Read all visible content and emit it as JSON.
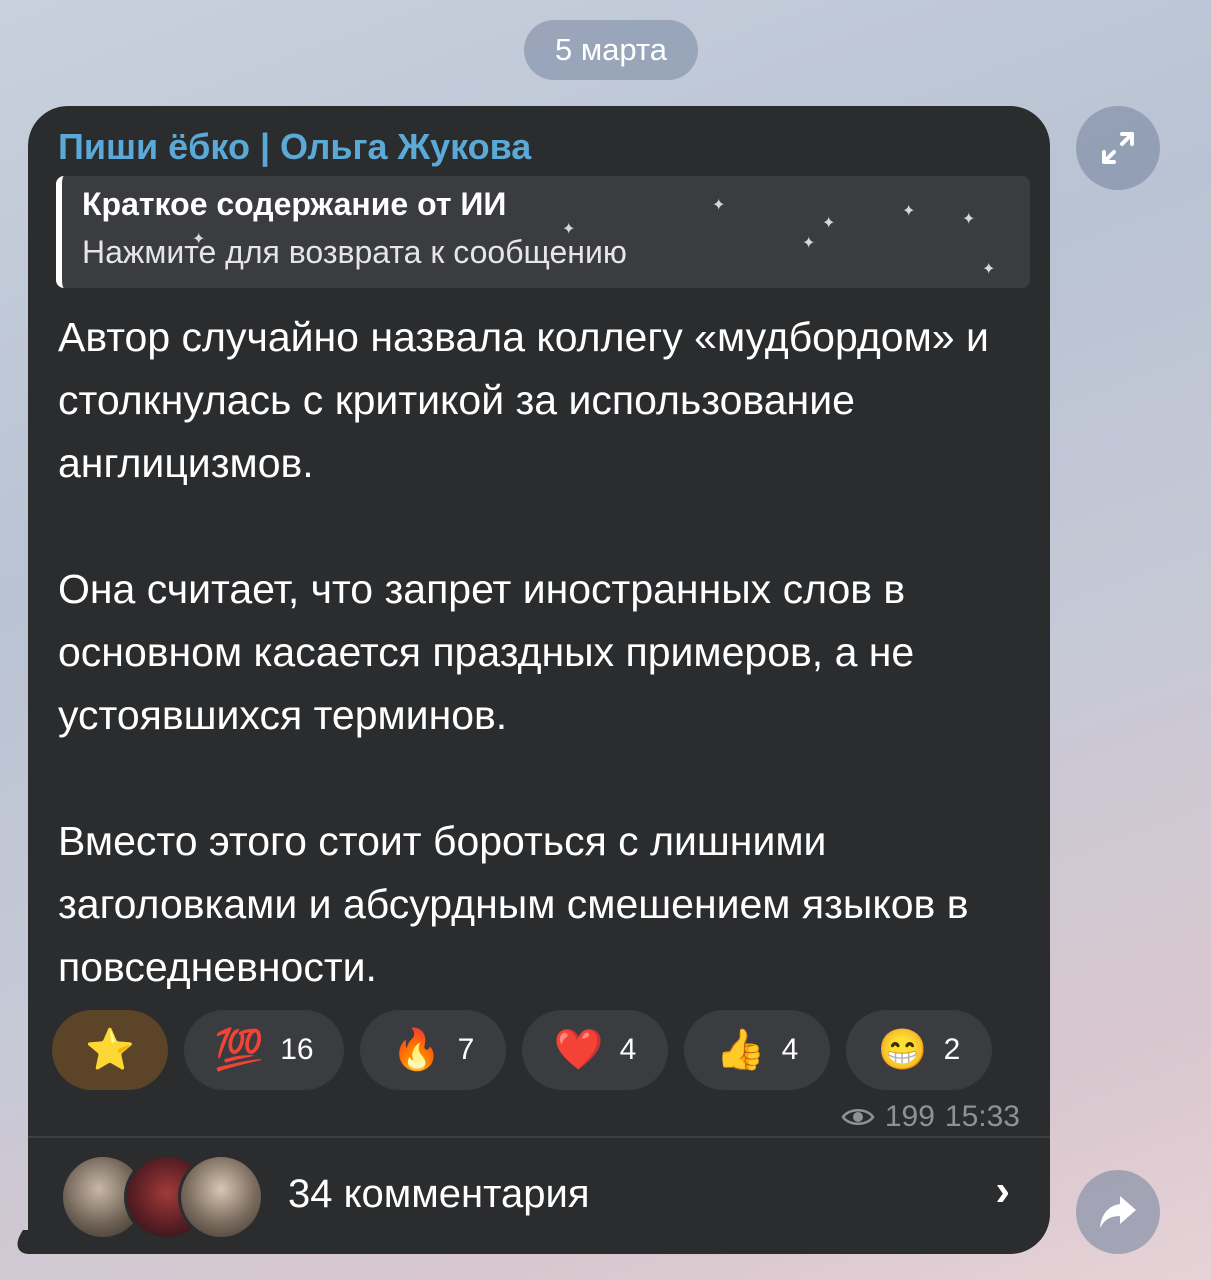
{
  "date_pill": "5 марта",
  "message": {
    "channel_name": "Пиши ёбко | Ольга Жукова",
    "quote": {
      "title": "Краткое содержание от ИИ",
      "subtitle": "Нажмите для возврата к сообщению"
    },
    "paragraphs": [
      "Автор случайно назвала коллегу «мудбордом» и столкнулась с критикой за использование англицизмов.",
      "Она считает, что запрет иностранных слов в основном касается праздных примеров, а не устоявшихся терминов.",
      "Вместо этого стоит бороться с лишними заголовками и абсурдным смешением языков в повседневности."
    ],
    "reactions": [
      {
        "emoji": "⭐",
        "count": "",
        "active": true
      },
      {
        "emoji": "💯",
        "count": "16"
      },
      {
        "emoji": "🔥",
        "count": "7"
      },
      {
        "emoji": "❤️",
        "count": "4"
      },
      {
        "emoji": "👍",
        "count": "4"
      },
      {
        "emoji": "😁",
        "count": "2"
      }
    ],
    "views": "199",
    "time": "15:33",
    "comments_label": "34 комментария"
  },
  "icons": {
    "views": "eye-icon",
    "comments_chevron": "chevron-right-icon",
    "expand": "expand-icon",
    "forward": "forward-arrow-icon"
  }
}
